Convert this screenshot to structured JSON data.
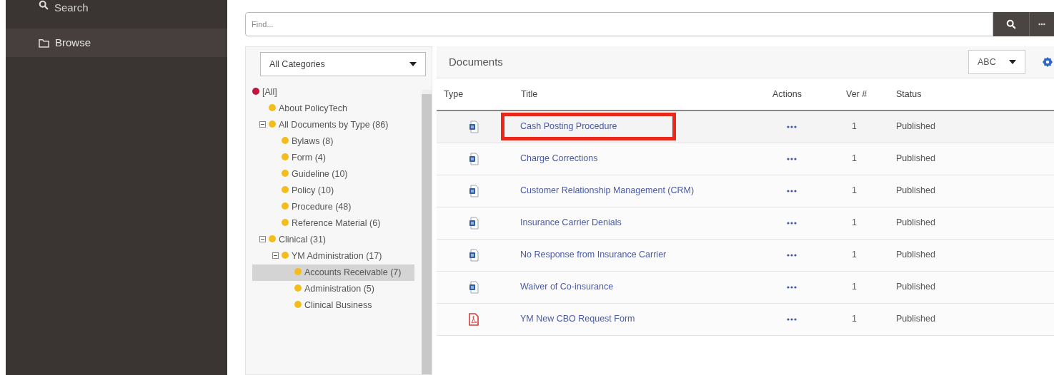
{
  "sidebar": {
    "items": [
      {
        "label": "Search",
        "kind": "search",
        "selected": false
      },
      {
        "label": "Browse",
        "kind": "folder",
        "selected": true
      }
    ]
  },
  "find": {
    "placeholder": "Find..."
  },
  "categories": {
    "value": "All Categories"
  },
  "tree": [
    {
      "label": "[All]",
      "color": "#c0163f",
      "selected": false,
      "children": [
        {
          "label": "About PolicyTech",
          "color": "#f2bd1d",
          "selected": false
        },
        {
          "label": "All Documents by Type (86)",
          "color": "#f2bd1d",
          "selected": false,
          "expanded": true,
          "children": [
            {
              "label": "Bylaws (8)",
              "color": "#f2bd1d",
              "selected": false
            },
            {
              "label": "Form (4)",
              "color": "#f2bd1d",
              "selected": false
            },
            {
              "label": "Guideline (10)",
              "color": "#f2bd1d",
              "selected": false
            },
            {
              "label": "Policy (10)",
              "color": "#f2bd1d",
              "selected": false
            },
            {
              "label": "Procedure (48)",
              "color": "#f2bd1d",
              "selected": false
            },
            {
              "label": "Reference Material (6)",
              "color": "#f2bd1d",
              "selected": false
            }
          ]
        },
        {
          "label": "Clinical (31)",
          "color": "#f2bd1d",
          "selected": false,
          "expanded": true,
          "children": [
            {
              "label": "YM Administration (17)",
              "color": "#f2bd1d",
              "selected": false,
              "expanded": true,
              "children": [
                {
                  "label": "Accounts Receivable (7)",
                  "color": "#f2bd1d",
                  "selected": true
                },
                {
                  "label": "Administration (5)",
                  "color": "#f2bd1d",
                  "selected": false
                },
                {
                  "label": "Clinical Business",
                  "color": "#f2bd1d",
                  "selected": false
                }
              ]
            }
          ]
        }
      ]
    }
  ],
  "documents": {
    "title": "Documents",
    "sort": "ABC",
    "columns": [
      "Type",
      "Title",
      "Actions",
      "Ver #",
      "Status"
    ],
    "rows": [
      {
        "kind": "doc",
        "title": "Cash Posting Procedure",
        "version": "1",
        "status": "Published",
        "highlighted": true
      },
      {
        "kind": "doc",
        "title": "Charge Corrections",
        "version": "1",
        "status": "Published",
        "highlighted": false
      },
      {
        "kind": "doc",
        "title": "Customer Relationship Management (CRM)",
        "version": "1",
        "status": "Published",
        "highlighted": false
      },
      {
        "kind": "doc",
        "title": "Insurance Carrier Denials",
        "version": "1",
        "status": "Published",
        "highlighted": false
      },
      {
        "kind": "doc",
        "title": "No Response from Insurance Carrier",
        "version": "1",
        "status": "Published",
        "highlighted": false
      },
      {
        "kind": "doc",
        "title": "Waiver of Co-insurance",
        "version": "1",
        "status": "Published",
        "highlighted": false
      },
      {
        "kind": "pdf",
        "title": "YM New CBO Request Form",
        "version": "1",
        "status": "Published",
        "highlighted": false
      }
    ]
  }
}
